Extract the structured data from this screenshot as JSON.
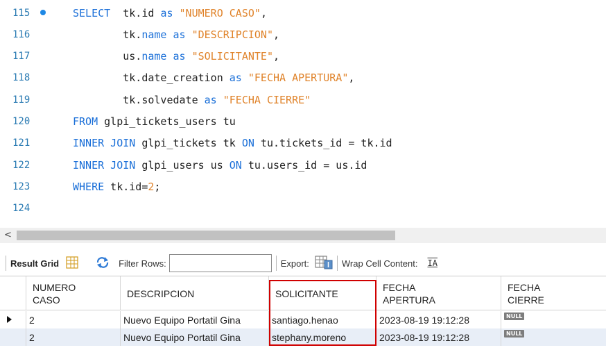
{
  "editor": {
    "lines": [
      {
        "no": "115",
        "marker": true,
        "parts": [
          {
            "t": "SELECT",
            "c": "kw"
          },
          {
            "t": "  tk.id "
          },
          {
            "t": "as",
            "c": "kw"
          },
          {
            "t": " "
          },
          {
            "t": "\"NUMERO CASO\"",
            "c": "str"
          },
          {
            "t": ","
          }
        ]
      },
      {
        "no": "116",
        "marker": false,
        "parts": [
          {
            "t": "        tk."
          },
          {
            "t": "name",
            "c": "kw"
          },
          {
            "t": " "
          },
          {
            "t": "as",
            "c": "kw"
          },
          {
            "t": " "
          },
          {
            "t": "\"DESCRIPCION\"",
            "c": "str"
          },
          {
            "t": ","
          }
        ]
      },
      {
        "no": "117",
        "marker": false,
        "parts": [
          {
            "t": "        us."
          },
          {
            "t": "name",
            "c": "kw"
          },
          {
            "t": " "
          },
          {
            "t": "as",
            "c": "kw"
          },
          {
            "t": " "
          },
          {
            "t": "\"SOLICITANTE\"",
            "c": "str"
          },
          {
            "t": ","
          }
        ]
      },
      {
        "no": "118",
        "marker": false,
        "parts": [
          {
            "t": "        tk.date_creation "
          },
          {
            "t": "as",
            "c": "kw"
          },
          {
            "t": " "
          },
          {
            "t": "\"FECHA APERTURA\"",
            "c": "str"
          },
          {
            "t": ","
          }
        ]
      },
      {
        "no": "119",
        "marker": false,
        "parts": [
          {
            "t": "        tk.solvedate "
          },
          {
            "t": "as",
            "c": "kw"
          },
          {
            "t": " "
          },
          {
            "t": "\"FECHA CIERRE\"",
            "c": "str"
          }
        ]
      },
      {
        "no": "120",
        "marker": false,
        "parts": [
          {
            "t": "FROM",
            "c": "kw"
          },
          {
            "t": " glpi_tickets_users tu"
          }
        ]
      },
      {
        "no": "121",
        "marker": false,
        "parts": [
          {
            "t": "INNER JOIN",
            "c": "kw"
          },
          {
            "t": " glpi_tickets tk "
          },
          {
            "t": "ON",
            "c": "kw"
          },
          {
            "t": " tu.tickets_id = tk.id"
          }
        ]
      },
      {
        "no": "122",
        "marker": false,
        "parts": [
          {
            "t": "INNER JOIN",
            "c": "kw"
          },
          {
            "t": " glpi_users us "
          },
          {
            "t": "ON",
            "c": "kw"
          },
          {
            "t": " tu.users_id = us.id"
          }
        ]
      },
      {
        "no": "123",
        "marker": false,
        "parts": [
          {
            "t": "WHERE",
            "c": "kw"
          },
          {
            "t": " tk.id="
          },
          {
            "t": "2",
            "c": "num"
          },
          {
            "t": ";"
          }
        ]
      },
      {
        "no": "124",
        "marker": false,
        "parts": []
      }
    ]
  },
  "scrollbar": {
    "left_arrow": "<"
  },
  "toolbar": {
    "result_grid": "Result Grid",
    "filter_rows": "Filter Rows:",
    "filter_value": "",
    "export": "Export:",
    "wrap_cell": "Wrap Cell Content:",
    "wrap_icon": "IA"
  },
  "grid": {
    "columns": [
      {
        "line1": "NUMERO",
        "line2": "CASO"
      },
      {
        "line1": "DESCRIPCION",
        "line2": ""
      },
      {
        "line1": "SOLICITANTE",
        "line2": ""
      },
      {
        "line1": "FECHA",
        "line2": "APERTURA"
      },
      {
        "line1": "FECHA",
        "line2": "CIERRE"
      }
    ],
    "rows": [
      {
        "numero": "2",
        "descripcion": "Nuevo Equipo Portatil Gina",
        "solicitante": "santiago.henao",
        "apertura": "2023-08-19 19:12:28",
        "cierre": "NULL"
      },
      {
        "numero": "2",
        "descripcion": "Nuevo Equipo Portatil Gina",
        "solicitante": "stephany.moreno",
        "apertura": "2023-08-19 19:12:28",
        "cierre": "NULL"
      }
    ]
  },
  "colors": {
    "keyword": "#1a6fd8",
    "string": "#e0832a",
    "line_number": "#2b7bb3",
    "highlight": "#d00000"
  }
}
